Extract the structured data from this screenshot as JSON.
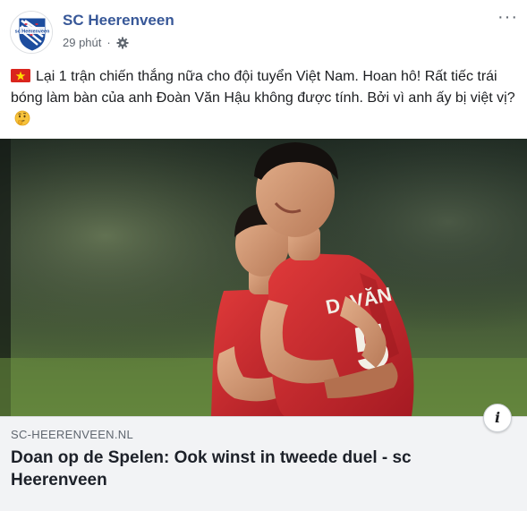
{
  "post": {
    "author": "SC Heerenveen",
    "time": "29 phút",
    "dot": "·",
    "privacy_icon": "gear-icon",
    "more_label": "···",
    "message_text": "Lại 1 trận chiến thắng nữa cho đội tuyển Việt Nam. Hoan hô! Rất tiếc trái bóng làm bàn của anh Đoàn Văn Hậu không được tính. Bởi vì anh ấy bị việt vị?",
    "flag_icon": "vietnam-flag-icon",
    "emoji_icon": "thinking-face-icon"
  },
  "photo": {
    "jersey_text": "D. VĂN"
  },
  "link": {
    "domain": "SC-HEERENVEEN.NL",
    "title": "Doan op de Spelen: Ook winst in tweede duel - sc Heerenveen",
    "info_label": "i"
  },
  "colors": {
    "author": "#385898",
    "meta": "#606770",
    "link_bg": "#f2f3f5",
    "jersey_red": "#c8242b"
  }
}
